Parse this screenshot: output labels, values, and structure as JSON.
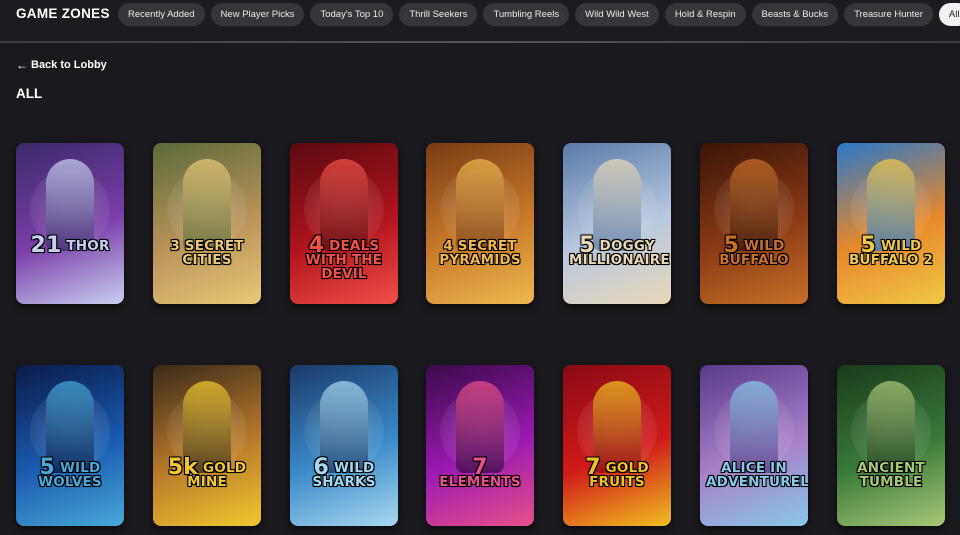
{
  "header": {
    "title": "GAME ZONES",
    "pills": [
      "Recently Added",
      "New Player Picks",
      "Today's Top 10",
      "Thrill Seekers",
      "Tumbling Reels",
      "Wild Wild West",
      "Hold & Respin",
      "Beasts & Bucks",
      "Treasure Hunter",
      "All"
    ],
    "active_pill": "All"
  },
  "nav": {
    "back_label": "Back to Lobby",
    "back_icon": "arrow-left-icon"
  },
  "section": {
    "title": "ALL"
  },
  "games": [
    {
      "title": "THOR",
      "badge": "21",
      "colors": [
        "#3a2a6a",
        "#7a3ea8",
        "#c8d0f0"
      ]
    },
    {
      "title": "3 SECRET CITIES",
      "badge": "",
      "colors": [
        "#5a6a3a",
        "#b9935a",
        "#e8c877"
      ]
    },
    {
      "title": "DEALS WITH THE DEVIL",
      "badge": "4",
      "colors": [
        "#5a0a10",
        "#b0141c",
        "#f05048"
      ]
    },
    {
      "title": "4 SECRET PYRAMIDS",
      "badge": "",
      "colors": [
        "#7a3a14",
        "#c77a2a",
        "#f0b850"
      ]
    },
    {
      "title": "DOGGY MILLIONAIRE",
      "badge": "5",
      "colors": [
        "#5a7aa8",
        "#b8c8e0",
        "#e8d8b8"
      ]
    },
    {
      "title": "WILD BUFFALO",
      "badge": "5",
      "colors": [
        "#3a1408",
        "#8a3a14",
        "#c87028"
      ]
    },
    {
      "title": "WILD BUFFALO 2",
      "badge": "5",
      "colors": [
        "#2a78c8",
        "#e8882a",
        "#f0c848"
      ]
    },
    {
      "title": "WILD WOLVES",
      "badge": "5",
      "colors": [
        "#0a1a48",
        "#1a5ab0",
        "#48a8d8"
      ]
    },
    {
      "title": "GOLD MINE",
      "badge": "5k",
      "colors": [
        "#3a2a1a",
        "#b87a2a",
        "#f0c830"
      ]
    },
    {
      "title": "WILD SHARKS",
      "badge": "6",
      "colors": [
        "#1a3a6a",
        "#3a8ac8",
        "#a8d8f0"
      ]
    },
    {
      "title": "ELEMENTS",
      "badge": "7",
      "colors": [
        "#3a0a4a",
        "#9a1ab0",
        "#e8508a"
      ]
    },
    {
      "title": "GOLD FRUITS",
      "badge": "7",
      "colors": [
        "#8a0a14",
        "#d01a1a",
        "#f0c020"
      ]
    },
    {
      "title": "ALICE IN ADVENTURELAND",
      "badge": "",
      "colors": [
        "#5a3a8a",
        "#a880c8",
        "#88c8e8"
      ]
    },
    {
      "title": "ANCIENT TUMBLE",
      "badge": "",
      "colors": [
        "#1a3a1a",
        "#3a7a3a",
        "#a8c878"
      ]
    }
  ]
}
